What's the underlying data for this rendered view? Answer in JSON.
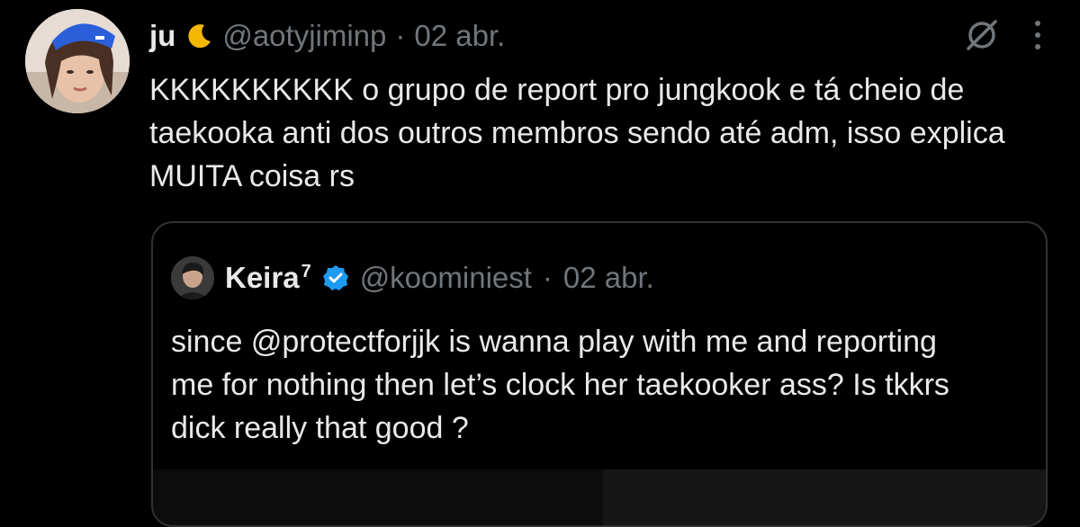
{
  "tweet": {
    "author_name": "ju",
    "author_handle": "@aotyjiminp",
    "separator": "·",
    "date": "02 abr.",
    "text": "KKKKKKKKKK o grupo de report pro jungkook e tá cheio de taekooka anti dos outros membros sendo até adm, isso explica MUITA coisa rs",
    "icons": {
      "name_emoji": "crescent-moon-icon",
      "grok": "grok-icon",
      "more": "more-vertical-icon"
    }
  },
  "quote": {
    "author_name": "Keira",
    "author_superscript": "7",
    "author_handle": "@koominiest",
    "separator": "·",
    "date": "02 abr.",
    "text": "since @protectforjjk is wanna play with me and reporting me for nothing then let’s clock her taekooker ass? Is tkkrs dick really that good ?",
    "icons": {
      "verified": "verified-badge-icon"
    }
  },
  "colors": {
    "background": "#000000",
    "text": "#e7e9ea",
    "secondary": "#71767b",
    "verified": "#1d9bf0",
    "moon": "#f5b800",
    "border": "#2f3336"
  }
}
